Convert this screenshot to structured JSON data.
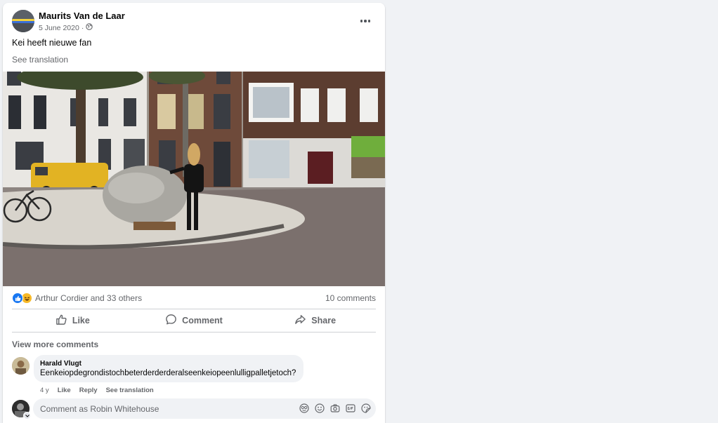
{
  "post": {
    "author": "Maurits Van de Laar",
    "date": "5 June 2020",
    "separator": "·",
    "audience_icon": "globe-icon",
    "text": "Kei heeft nieuwe fan",
    "see_translation": "See translation"
  },
  "stats": {
    "reactions": [
      "like",
      "haha"
    ],
    "reaction_names": "Arthur Cordier and 33 others",
    "comments_count": "10 comments"
  },
  "actions": {
    "like": "Like",
    "comment": "Comment",
    "share": "Share"
  },
  "comments": {
    "view_more": "View more comments",
    "items": [
      {
        "author": "Harald Vlugt",
        "text": "Eenkeiopdegrondistochbeterderderderalseenkeiopeenlulligpalletjetoch?",
        "age": "4 y",
        "like": "Like",
        "reply": "Reply",
        "see_translation": "See translation"
      }
    ]
  },
  "composer": {
    "placeholder": "Comment as Robin Whitehouse",
    "tools": [
      "avatar-sticker-icon",
      "emoji-icon",
      "camera-icon",
      "gif-icon",
      "sticker-icon"
    ]
  },
  "colors": {
    "accent": "#1877f2",
    "secondary_text": "#65676b",
    "background": "#f0f2f5"
  }
}
